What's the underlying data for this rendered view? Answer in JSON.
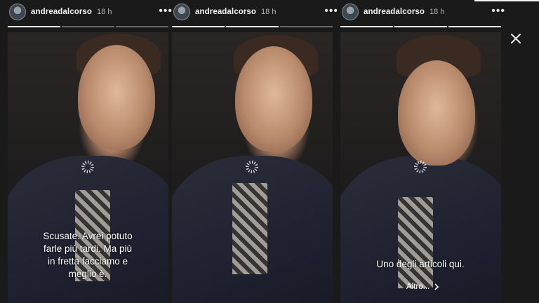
{
  "stories": [
    {
      "username": "andreadalcorso",
      "time": "18 h",
      "menu_icon": "more-icon",
      "progress": {
        "segments": 3,
        "current": 1
      },
      "caption": [
        "Scusate. Avrei potuto",
        "farle più tardi. Ma più",
        "in fretta facciamo e",
        "meglio è."
      ],
      "more_label": ""
    },
    {
      "username": "andreadalcorso",
      "time": "18 h",
      "menu_icon": "more-icon",
      "progress": {
        "segments": 3,
        "current": 2
      },
      "caption": [],
      "more_label": ""
    },
    {
      "username": "andreadalcorso",
      "time": "18 h",
      "menu_icon": "more-icon",
      "progress": {
        "segments": 3,
        "current": 3
      },
      "caption": [
        "Uno degli articoli qui."
      ],
      "more_label": "Altro..."
    }
  ],
  "close_icon": "close-icon",
  "colors": {
    "background": "#1a1a1a",
    "progress_done": "#f0f0f0",
    "progress_pending": "rgba(255,255,255,0.35)"
  }
}
